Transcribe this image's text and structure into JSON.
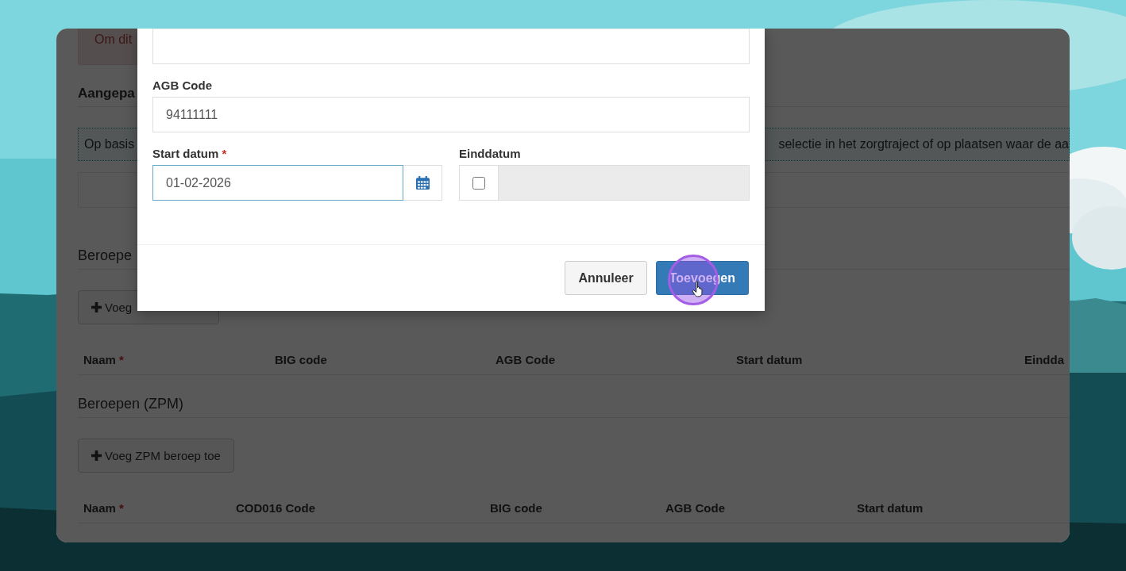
{
  "page": {
    "alert_text": "Om dit",
    "heading": "Aangepa",
    "notice_left": "Op basis",
    "notice_right": "selectie in het zorgtraject of op plaatsen waar de aa",
    "sections": [
      {
        "heading": "Beroepe",
        "add_button": "Voeg",
        "columns": [
          {
            "label": "Naam",
            "required_mark": "*"
          },
          {
            "label": "BIG code"
          },
          {
            "label": "AGB Code"
          },
          {
            "label": "Start datum"
          },
          {
            "label": "Eindda"
          }
        ]
      },
      {
        "heading": "Beroepen (ZPM)",
        "add_button": "Voeg ZPM beroep toe",
        "columns": [
          {
            "label": "Naam",
            "required_mark": "*"
          },
          {
            "label": "COD016 Code"
          },
          {
            "label": "BIG code"
          },
          {
            "label": "AGB Code"
          },
          {
            "label": "Start datum"
          }
        ]
      }
    ]
  },
  "dialog": {
    "fields": [
      {
        "kind": "text"
      },
      {
        "kind": "text",
        "label": "AGB Code",
        "value": "94111111"
      },
      {
        "kind": "pair",
        "items": [
          {
            "kind": "date",
            "label": "Start datum",
            "required_mark": "*",
            "value": "01-02-2026",
            "focused": true
          },
          {
            "kind": "optional_date",
            "label": "Einddatum",
            "checked": false,
            "disabled": true
          }
        ]
      }
    ],
    "buttons": [
      {
        "label": "Annuleer",
        "kind": "default"
      },
      {
        "label": "Toevoegen",
        "kind": "primary",
        "clicked": true
      }
    ]
  }
}
